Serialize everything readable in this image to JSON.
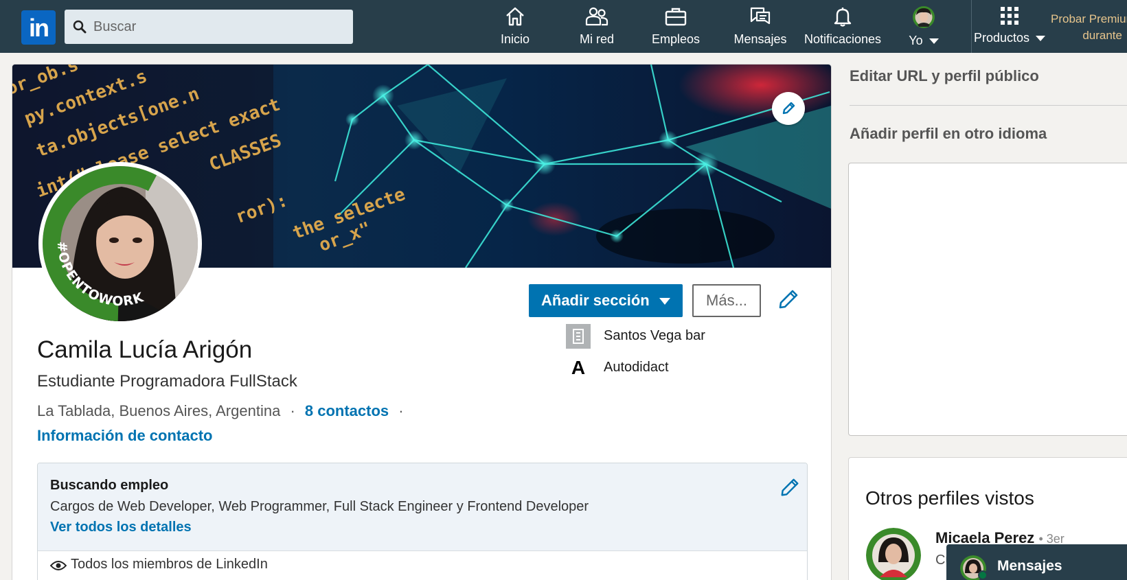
{
  "nav": {
    "logo": "in",
    "search_placeholder": "Buscar",
    "items": [
      {
        "label": "Inicio",
        "icon": "home-icon"
      },
      {
        "label": "Mi red",
        "icon": "network-icon"
      },
      {
        "label": "Empleos",
        "icon": "briefcase-icon"
      },
      {
        "label": "Mensajes",
        "icon": "messaging-icon"
      },
      {
        "label": "Notificaciones",
        "icon": "bell-icon"
      },
      {
        "label": "Yo",
        "icon": "me-avatar-icon"
      },
      {
        "label": "Productos",
        "icon": "grid-icon"
      }
    ],
    "premium_line1": "Probar Premium",
    "premium_line2": "durante"
  },
  "profile": {
    "avatar_badge": "#OPENTOWORK",
    "add_section": "Añadir sección",
    "more": "Más...",
    "name": "Camila Lucía Arigón",
    "headline": "Estudiante Programadora FullStack",
    "location": "La Tablada, Buenos Aires, Argentina",
    "separator": "·",
    "contacts": "8 contactos",
    "contact_info": "Información de contacto",
    "orgs": [
      {
        "name": "Santos Vega bar",
        "icon": "building-icon"
      },
      {
        "name": "Autodidact",
        "icon": "autodidact-logo"
      }
    ],
    "banner_code_lines": [
      "or_ob.s",
      "py.context.s",
      "ta.objects[one.n",
      "int(\"please select exact",
      "CLASSES",
      "ror):",
      "the selecte",
      "or_x\""
    ]
  },
  "open_to_work": {
    "title": "Buscando empleo",
    "description": "Cargos de Web Developer, Web Programmer, Full Stack Engineer y Frontend Developer",
    "details_link": "Ver todos los detalles",
    "visibility": "Todos los miembros de LinkedIn"
  },
  "sidebar": {
    "edit_url": "Editar URL y perfil público",
    "add_language": "Añadir perfil en otro idioma",
    "viewed_title": "Otros perfiles vistos",
    "viewed": [
      {
        "name": "Micaela Perez",
        "degree": "• 3er",
        "sub": "Cu"
      }
    ]
  },
  "messaging_bar": {
    "label": "Mensajes"
  },
  "colors": {
    "nav_bg": "#283e4a",
    "primary": "#0073b1",
    "premium": "#e7c58c",
    "open_to_work_green": "#3a8a2a"
  }
}
